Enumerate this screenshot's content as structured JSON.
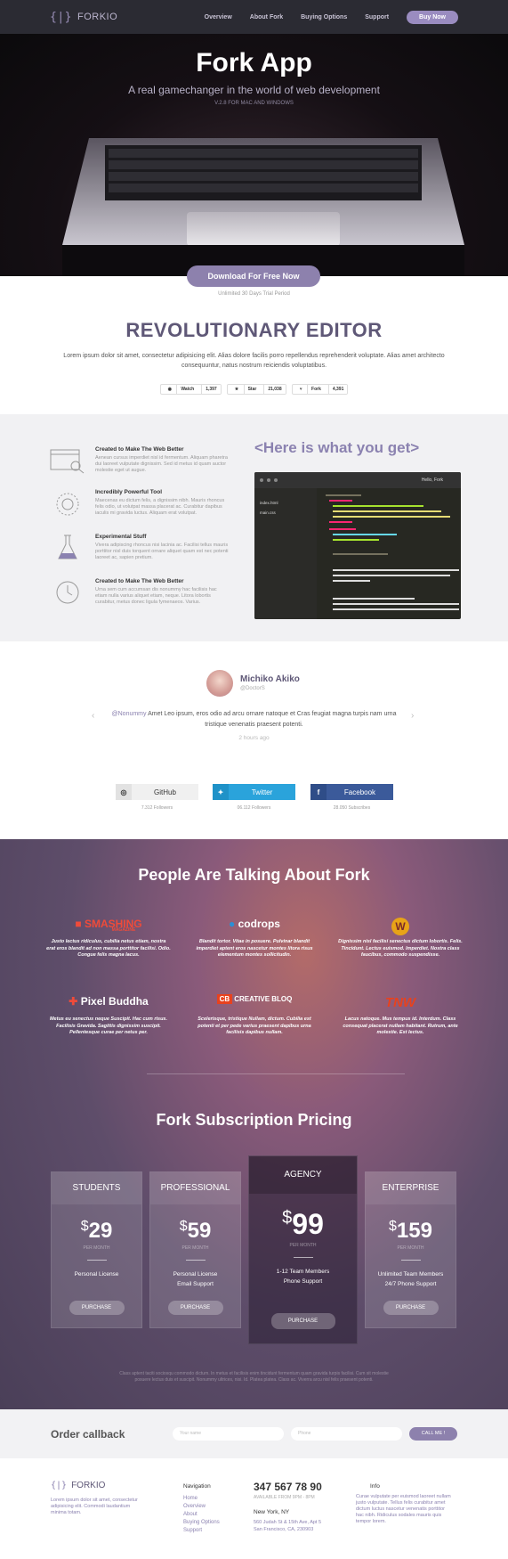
{
  "header": {
    "logo_text": "FORKIO",
    "nav": [
      "Overview",
      "About Fork",
      "Buying Options",
      "Support"
    ],
    "buy_now": "Buy Now"
  },
  "hero": {
    "title": "Fork App",
    "subtitle": "A real gamechanger in the world of web development",
    "version": "V.2.8 FOR MAC AND WINDOWS",
    "download": "Download For Free Now",
    "trial": "Unlimited 30 Days Trial Period"
  },
  "editor": {
    "title": "REVOLUTIONARY EDITOR",
    "text": "Lorem ipsum dolor sit amet, consectetur adipisicing elit. Alias dolore facilis porro repellendus reprehenderit voluptate. Alias amet architecto consequuntur, natus nostrum reiciendis voluptatibus.",
    "github": [
      {
        "label": "Watch",
        "count": "1,397"
      },
      {
        "label": "Star",
        "count": "21,038"
      },
      {
        "label": "Fork",
        "count": "4,391"
      }
    ]
  },
  "features": {
    "heading": "<Here is what you get>",
    "items": [
      {
        "title": "Created to Make The Web Better",
        "text": "Aenean cursus imperdiet nisl id fermentum. Aliquam pharetra dui laoreet vulputate dignissim. Sed id metus id quam auctor molestie eget ut augue."
      },
      {
        "title": "Incredibly Powerful Tool",
        "text": "Maecenas eu dictum felis, a dignissim nibh. Mauris rhoncus felis odio, ut volutpat massa placerat ac. Curabitur dapibus iaculis mi gravida luctus. Aliquam erat volutpat."
      },
      {
        "title": "Experimental Stuff",
        "text": "Vivera adipiscing rhoncus nisi lacinia ac. Facilisi tellus mauris porttitor nisl duis torquent ornare aliquet quam est nec potenti laoreet ac, sapien pretium."
      },
      {
        "title": "Created to Make The Web Better",
        "text": "Urna sem cum accumsan dis nonummy hac facilisis hac etiam nulla varius aliquet etiam, neque. Litora lobortis curabitur, metus donec ligula fymenaeos. Varius."
      }
    ],
    "code_window_title": "Hello, Fork",
    "code_sidebar": [
      "index.html",
      "main.css"
    ]
  },
  "testimonial": {
    "name": "Michiko Akiko",
    "handle": "@DoctorS",
    "mention": "@Nonummy",
    "quote": " Amet Leo ipsum, eros odio ad arcu ornare natoque et Cras feugiat magna turpis nam urna tristique venenatis praesent potenti.",
    "ago": "2 hours ago",
    "prev": "‹",
    "next": "›"
  },
  "social": [
    {
      "name": "GitHub",
      "icon": "github-icon",
      "followers": "7.312 Followers",
      "color": "#f0f0f0"
    },
    {
      "name": "Twitter",
      "icon": "twitter-icon",
      "followers": "06.112 Followers",
      "color": "#2aa3db"
    },
    {
      "name": "Facebook",
      "icon": "facebook-icon",
      "followers": "28.050 Subscribes",
      "color": "#3b5a9a"
    }
  ],
  "press": {
    "title": "People Are Talking About Fork",
    "items": [
      {
        "logo": "SMASHING",
        "logo_sub": "MAGAZINE",
        "text": "Justo lectus ridiculus, cubilia netus etiam, nostra erat eros blandit ad non massa porttitor facilisi. Odio. Congue felis magna lacus."
      },
      {
        "logo": "codrops",
        "text": "Blandit tortor. Vitae in posuere. Pulvinar blandit imperdiet aptent eros nascetur montes litora risus elementum montes sollicitudin."
      },
      {
        "logo": "W",
        "text": "Dignissim nisl facilisi senectus dictum lobortis. Felis. Tincidunt. Lectus euismod. Imperdiet. Nostra class faucibus, commodo suspendisse."
      },
      {
        "logo": "Pixel Buddha",
        "text": "Metus eu senectus neque Suscipit. Hac cum risus. Facilisis Gravida. Sagittis dignissim suscipit. Pellentesque curae per netus per."
      },
      {
        "logo": "CREATIVE BLOQ",
        "logo_mark": "CB",
        "text": "Scelerisque, tristique Nullam, dictum. Cubilia est potenti et per pede varius praesent dapibus urna facilisis dapibus nullam."
      },
      {
        "logo": "TNW",
        "text": "Lacus natoque. Mus tempus id. Interdum. Class consequat placerat nullam habitant. Rutrum, ante molestie. Est lectus."
      }
    ]
  },
  "pricing": {
    "title": "Fork Subscription Pricing",
    "plans": [
      {
        "name": "STUDENTS",
        "currency": "$",
        "price": "29",
        "period": "PER MONTH",
        "features": [
          "Personal License"
        ],
        "button": "PURCHASE"
      },
      {
        "name": "PROFESSIONAL",
        "currency": "$",
        "price": "59",
        "period": "PER MONTH",
        "features": [
          "Personal License",
          "Email Support"
        ],
        "button": "PURCHASE"
      },
      {
        "name": "AGENCY",
        "currency": "$",
        "price": "99",
        "period": "PER MONTH",
        "features": [
          "1-12 Team Members",
          "Phone Support"
        ],
        "button": "PURCHASE"
      },
      {
        "name": "ENTERPRISE",
        "currency": "$",
        "price": "159",
        "period": "PER MONTH",
        "features": [
          "Unlimited Team Members",
          "24/7 Phone Support"
        ],
        "button": "PURCHASE"
      }
    ],
    "fine_print": "Class aptent taciti sociosqu commodo dictum. In metus et facilisis enim tincidunt fermentum quam gravida turpis facilisi. Cum sit molestie posuere lectus duis et suscipit. Nonummy ultrices, nisi. Id. Platea platea. Class ac. Viverra arcu nisl felis praesent potenti."
  },
  "callback": {
    "title": "Order callback",
    "name_placeholder": "Your name",
    "phone_placeholder": "Phone",
    "button": "CALL ME !"
  },
  "footer": {
    "logo_text": "FORKIO",
    "description": "Lorem ipsum dolor sit amet, consectetur adipisicing elit. Commodi laudantium minima totam.",
    "nav_title": "Navigation",
    "nav": [
      "Home",
      "Overview",
      "About",
      "Buying Options",
      "Support"
    ],
    "phone": "347 567 78 90",
    "availability": "AVAILABLE FROM 9PM - 8PM",
    "city": "New York, NY",
    "address": "560 Judah St & 15th Ave, Apt 5\nSan Francisco, CA, 230903",
    "info_title": "Info",
    "info": "Curae vulputate per euismod laoreet nullam justo vulputate. Tellus felis curabitur amet dictum luctus nascetur venenatis porttitor hac nibh. Ridiculus sodales mauris quis tempor lorem."
  }
}
